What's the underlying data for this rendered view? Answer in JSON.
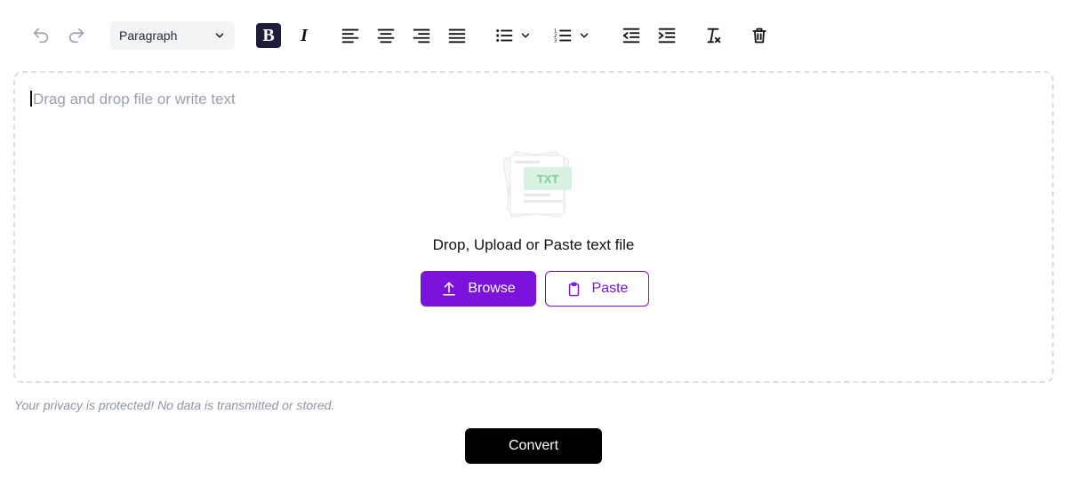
{
  "toolbar": {
    "undo_icon": "undo-icon",
    "redo_icon": "redo-icon",
    "block_format": "Paragraph",
    "bold_label": "B",
    "italic_label": "I",
    "icons": [
      "align-left-icon",
      "align-center-icon",
      "align-right-icon",
      "align-justify-icon",
      "bullet-list-icon",
      "numbered-list-icon",
      "outdent-icon",
      "indent-icon",
      "clear-format-icon",
      "trash-icon"
    ]
  },
  "editor": {
    "placeholder": "Drag and drop file or write text",
    "illustration_label": "TXT",
    "drop_title": "Drop, Upload or Paste text file",
    "browse_label": "Browse",
    "paste_label": "Paste"
  },
  "footer": {
    "privacy_note": "Your privacy is protected! No data is transmitted or stored.",
    "convert_label": "Convert"
  },
  "colors": {
    "accent": "#7c13dc",
    "dark": "#1e1e3a",
    "placeholder": "#9aa1ab",
    "border": "#dcdfe4",
    "txt_green": "#7fcf9b"
  }
}
